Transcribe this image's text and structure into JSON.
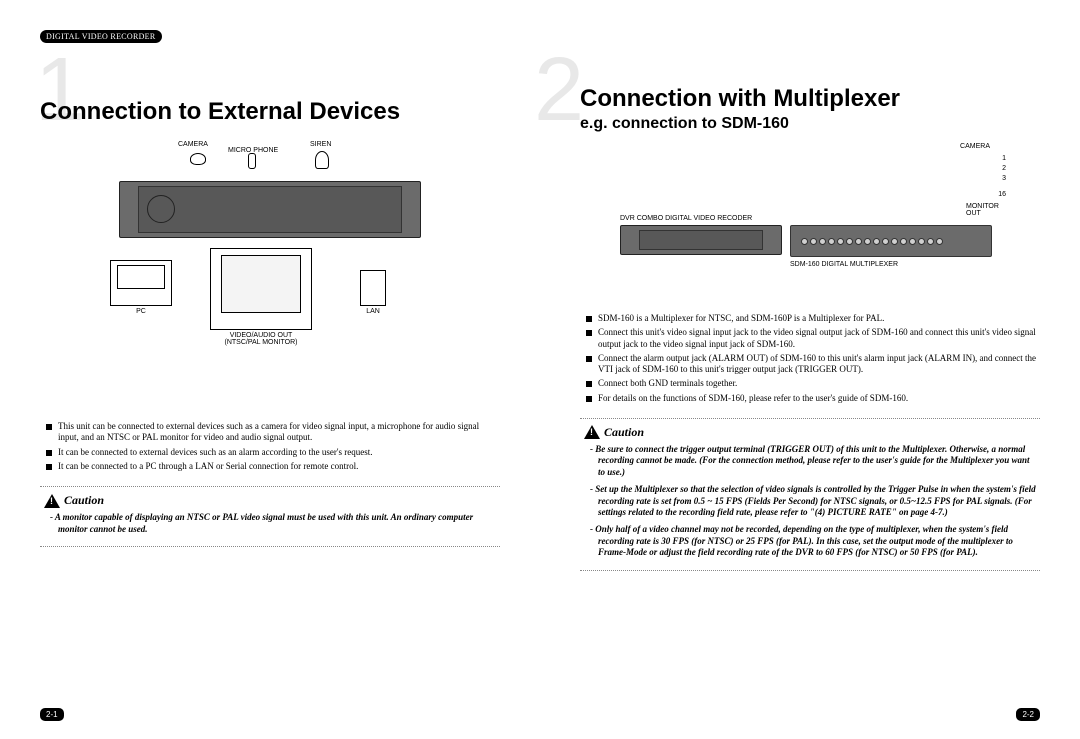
{
  "header_badge": "DIGITAL VIDEO RECORDER",
  "section1": {
    "num": "1",
    "title": "Connection to External Devices",
    "labels": {
      "camera": "CAMERA",
      "micro": "MICRO PHONE",
      "siren": "SIREN",
      "pc": "PC",
      "video_audio": "VIDEO/AUDIO OUT",
      "ntsc_pal": "(NTSC/PAL MONITOR)",
      "lan": "LAN"
    },
    "bullets": [
      "This unit can be connected to external devices such as a camera for video signal input, a microphone for audio signal input, and an NTSC or PAL monitor for video and audio signal output.",
      "It can be connected to external devices such as an alarm according to the user's request.",
      "It can be connected to a PC through a LAN or Serial connection for remote control."
    ],
    "caution_title": "Caution",
    "caution_items": [
      "- A monitor capable of displaying an NTSC or PAL video signal must be used with this unit. An ordinary computer monitor cannot be used."
    ],
    "page_num": "2-1"
  },
  "section2": {
    "num": "2",
    "title": "Connection with Multiplexer",
    "subtitle": "e.g. connection to SDM-160",
    "labels": {
      "camera": "CAMERA",
      "cam1": "1",
      "cam2": "2",
      "cam3": "3",
      "cam16": "16",
      "monitor_out": "MONITOR OUT",
      "dvr": "DVR COMBO DIGITAL VIDEO RECODER",
      "mux": "SDM-160 DIGITAL MULTIPLEXER"
    },
    "bullets": [
      "SDM-160 is a Multiplexer for NTSC, and SDM-160P is a Multiplexer for PAL.",
      "Connect this unit's video signal input jack to the video signal output jack of SDM-160 and connect this unit's video signal output jack to the video signal input jack of SDM-160.",
      "Connect the alarm output jack (ALARM OUT) of SDM-160 to this unit's alarm input jack (ALARM IN), and connect the VTI jack of SDM-160 to this unit's trigger output jack (TRIGGER OUT).",
      "Connect both GND terminals together.",
      "For details on the functions of SDM-160, please refer to the user's guide of SDM-160."
    ],
    "caution_title": "Caution",
    "caution_items": [
      "- Be sure to connect the trigger output terminal (TRIGGER OUT) of this unit to the Multiplexer. Otherwise, a normal recording cannot be made. (For the connection method, please refer to the user's guide for the Multiplexer you want to use.)",
      "- Set up the Multiplexer so that the selection of video signals is controlled by the Trigger Pulse in when the system's field recording rate is set from 0.5 ~ 15 FPS (Fields Per Second) for NTSC signals, or 0.5~12.5 FPS for PAL signals. (For settings related to the recording field rate, please refer to \"(4) PICTURE RATE\" on page 4-7.)",
      "- Only half of a video channel may not be recorded, depending on the type of multiplexer, when the system's field recording rate is 30 FPS (for NTSC) or 25 FPS (for PAL). In this case, set the output mode of the multiplexer to Frame-Mode or adjust the field recording rate of the DVR to 60 FPS (for NTSC) or 50 FPS (for PAL)."
    ],
    "page_num": "2-2"
  }
}
